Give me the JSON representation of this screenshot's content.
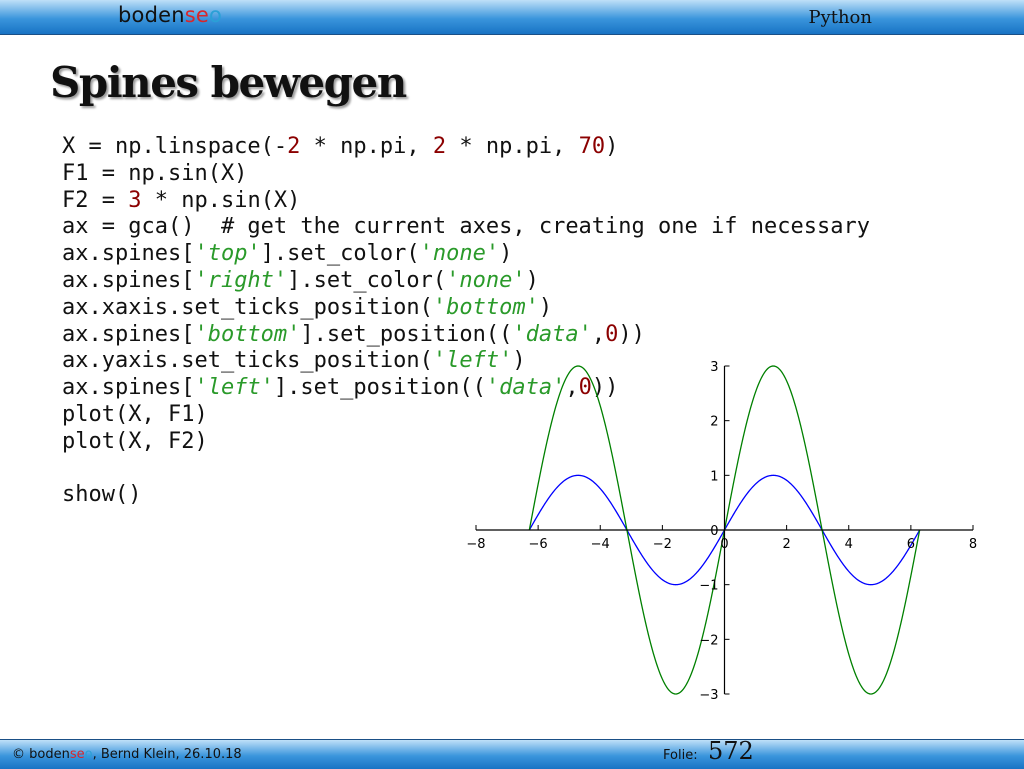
{
  "header": {
    "logo_parts": [
      "boden",
      "se",
      "o"
    ],
    "right_label": "Python"
  },
  "slide": {
    "title": "Spines bewegen"
  },
  "code_lines": [
    [
      [
        "X = np.linspace(-",
        "t"
      ],
      [
        "2",
        "n"
      ],
      [
        " * np.pi, ",
        "t"
      ],
      [
        "2",
        "n"
      ],
      [
        " * np.pi, ",
        "t"
      ],
      [
        "70",
        "n"
      ],
      [
        ")",
        "t"
      ]
    ],
    [
      [
        "F1 = np.sin(X)",
        "t"
      ]
    ],
    [
      [
        "F2 = ",
        "t"
      ],
      [
        "3",
        "n"
      ],
      [
        " * np.sin(X)",
        "t"
      ]
    ],
    [
      [
        "ax = gca()  # get the current axes, creating one if necessary",
        "t"
      ]
    ],
    [
      [
        "ax.spines[",
        "t"
      ],
      [
        "'top'",
        "s"
      ],
      [
        "].set_color(",
        "t"
      ],
      [
        "'none'",
        "s"
      ],
      [
        ")",
        "t"
      ]
    ],
    [
      [
        "ax.spines[",
        "t"
      ],
      [
        "'right'",
        "s"
      ],
      [
        "].set_color(",
        "t"
      ],
      [
        "'none'",
        "s"
      ],
      [
        ")",
        "t"
      ]
    ],
    [
      [
        "ax.xaxis.set_ticks_position(",
        "t"
      ],
      [
        "'bottom'",
        "s"
      ],
      [
        ")",
        "t"
      ]
    ],
    [
      [
        "ax.spines[",
        "t"
      ],
      [
        "'bottom'",
        "s"
      ],
      [
        "].set_position((",
        "t"
      ],
      [
        "'data'",
        "s"
      ],
      [
        ",",
        "t"
      ],
      [
        "0",
        "n"
      ],
      [
        "))",
        "t"
      ]
    ],
    [
      [
        "ax.yaxis.set_ticks_position(",
        "t"
      ],
      [
        "'left'",
        "s"
      ],
      [
        ")",
        "t"
      ]
    ],
    [
      [
        "ax.spines[",
        "t"
      ],
      [
        "'left'",
        "s"
      ],
      [
        "].set_position((",
        "t"
      ],
      [
        "'data'",
        "s"
      ],
      [
        ",",
        "t"
      ],
      [
        "0",
        "n"
      ],
      [
        "))",
        "t"
      ]
    ],
    [
      [
        "plot(X, F1)",
        "t"
      ]
    ],
    [
      [
        "plot(X, F2)",
        "t"
      ]
    ],
    [
      [
        "",
        "t"
      ]
    ],
    [
      [
        "show()",
        "t"
      ]
    ]
  ],
  "chart_data": {
    "type": "line",
    "title": "",
    "xlabel": "",
    "ylabel": "",
    "xlim": [
      -8,
      8
    ],
    "ylim": [
      -3,
      3
    ],
    "x_ticks": [
      -8,
      -6,
      -4,
      -2,
      0,
      2,
      4,
      6,
      8
    ],
    "y_ticks": [
      -3,
      -2,
      -1,
      0,
      1,
      2,
      3
    ],
    "x_tick_labels": [
      "−8",
      "−6",
      "−4",
      "−2",
      "0",
      "2",
      "4",
      "6",
      "8"
    ],
    "y_tick_labels": [
      "−3",
      "−2",
      "−1",
      "0",
      "1",
      "2",
      "3"
    ],
    "spines": "centered at data origin (left and bottom only)",
    "grid": false,
    "series": [
      {
        "color": "#0000ff",
        "x": [
          -6.2832,
          -5.4978,
          -4.7124,
          -3.927,
          -3.1416,
          -2.3562,
          -1.5708,
          -0.7854,
          0,
          0.7854,
          1.5708,
          2.3562,
          3.1416,
          3.927,
          4.7124,
          5.4978,
          6.2832
        ],
        "y": [
          0,
          0.707,
          1,
          0.707,
          0,
          -0.707,
          -1,
          -0.707,
          0,
          0.707,
          1,
          0.707,
          0,
          -0.707,
          -1,
          -0.707,
          0
        ]
      },
      {
        "color": "#008000",
        "x": [
          -6.2832,
          -5.4978,
          -4.7124,
          -3.927,
          -3.1416,
          -2.3562,
          -1.5708,
          -0.7854,
          0,
          0.7854,
          1.5708,
          2.3562,
          3.1416,
          3.927,
          4.7124,
          5.4978,
          6.2832
        ],
        "y": [
          0,
          2.121,
          3,
          2.121,
          0,
          -2.121,
          -3,
          -2.121,
          0,
          2.121,
          3,
          2.121,
          0,
          -2.121,
          -3,
          -2.121,
          0
        ]
      }
    ]
  },
  "footer": {
    "copyright_prefix": "© ",
    "logo_parts": [
      "boden",
      "se",
      "o"
    ],
    "author_text": ", Bernd Klein, 26.10.18",
    "folie_label": "Folie:",
    "folie_number": "572"
  }
}
